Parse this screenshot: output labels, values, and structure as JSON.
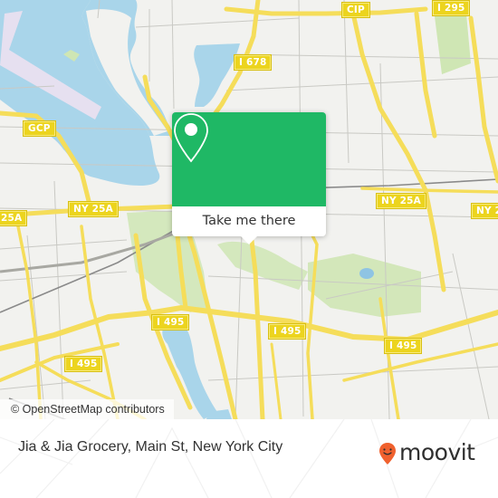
{
  "map": {
    "attribution": "© OpenStreetMap contributors",
    "road_labels": [
      {
        "id": "gcp-west",
        "text": "GCP"
      },
      {
        "id": "cip-north",
        "text": "CIP"
      },
      {
        "id": "i295-north",
        "text": "I 295"
      },
      {
        "id": "i678",
        "text": "I 678"
      },
      {
        "id": "ny25a-west",
        "text": "25A"
      },
      {
        "id": "ny25a-center",
        "text": "NY 25A"
      },
      {
        "id": "ny25a-east",
        "text": "NY 25A"
      },
      {
        "id": "ny25a-far-east",
        "text": "NY 2"
      },
      {
        "id": "i495-park",
        "text": "I 495"
      },
      {
        "id": "i495-mid",
        "text": "I 495"
      },
      {
        "id": "i495-east",
        "text": "I 495"
      },
      {
        "id": "i495-west",
        "text": "I 495"
      }
    ],
    "colors": {
      "land": "#f2f2ef",
      "water": "#a9d5ea",
      "park": "#cfe6b4",
      "highway": "#f5dd5a",
      "road_minor": "#c9c9c4",
      "rail": "#7a7a7a",
      "airport": "#e6e0f0"
    }
  },
  "popup": {
    "icon": "location-pin-icon",
    "button_label": "Take me there",
    "color": "#1fb865"
  },
  "footer": {
    "place_title": "Jia & Jia Grocery, Main St, New York City",
    "brand_name": "moovit",
    "brand_icon": "moovit-smiley-pin-icon",
    "brand_color": "#f0612e"
  }
}
